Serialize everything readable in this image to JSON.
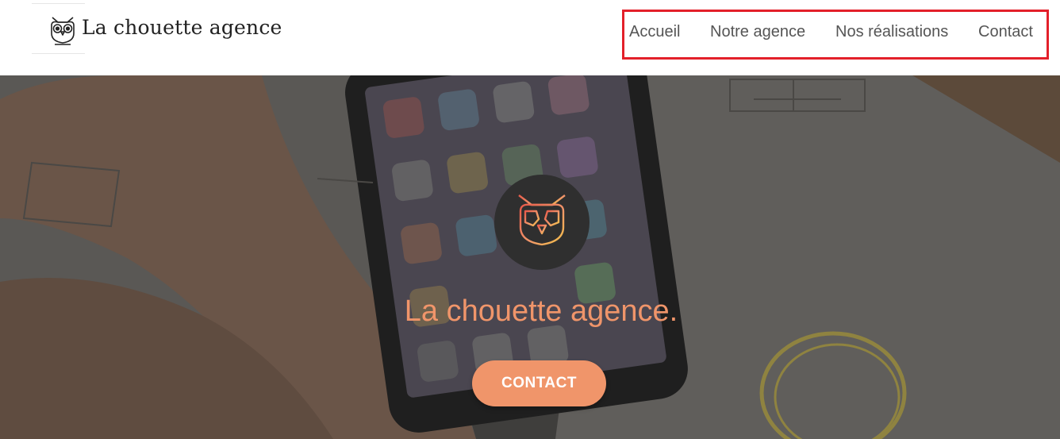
{
  "header": {
    "logo_text": "La chouette agence",
    "nav": [
      {
        "label": "Accueil"
      },
      {
        "label": "Notre agence"
      },
      {
        "label": "Nos réalisations"
      },
      {
        "label": "Contact"
      }
    ]
  },
  "hero": {
    "title": "La chouette agence.",
    "cta_label": "CONTACT"
  },
  "colors": {
    "accent": "#f0956a",
    "nav_highlight": "#e3202a",
    "overlay": "#3d3d3b"
  },
  "icons": [
    "owl-logo-icon",
    "owl-emblem-icon"
  ]
}
